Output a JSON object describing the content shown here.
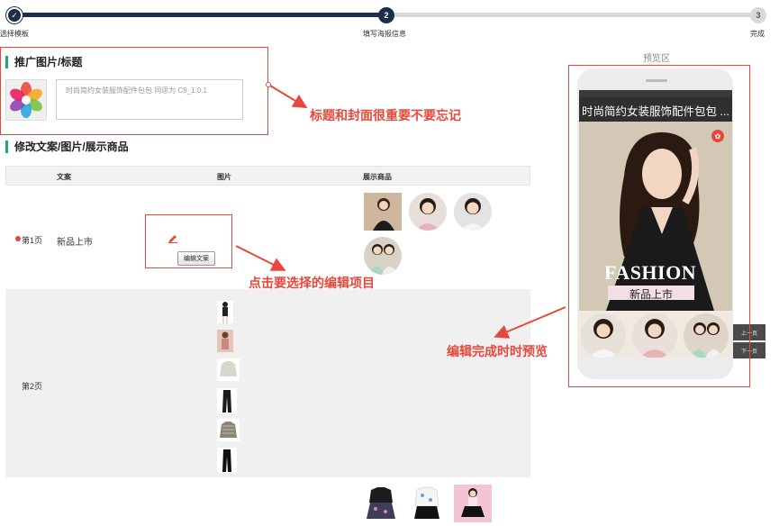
{
  "stepper": {
    "steps": [
      {
        "label": "选择模板",
        "marker": "✓"
      },
      {
        "label": "填写海报信息",
        "marker": "2"
      },
      {
        "label": "完成",
        "marker": "3"
      }
    ],
    "colors": {
      "done": "#1e2d4a",
      "pending": "#d9d9d9"
    }
  },
  "promo": {
    "heading": "推广图片/标题",
    "title_value": "时尚简约女装服饰配件包包 同思为 C9_1.0.1"
  },
  "edit": {
    "heading": "修改文案/图片/展示商品",
    "columns": [
      "文案",
      "图片",
      "展示商品"
    ],
    "rows": [
      {
        "page": "第1页",
        "copy": "新品上市",
        "button": "编辑文案"
      },
      {
        "page": "第2页",
        "copy": "",
        "button": ""
      }
    ]
  },
  "preview": {
    "heading": "预览区",
    "poster_title": "时尚简约女装服饰配件包包 ...",
    "banner_word": "FASHION",
    "banner_sub": "新品上市",
    "prev_page": "上一页",
    "next_page": "下一页"
  },
  "annotations": {
    "title_note": "标题和封面很重要不要忘记",
    "edit_note": "点击要选择的编辑项目",
    "preview_note": "编辑完成时时预览"
  },
  "colors": {
    "accent_red": "#e8483c",
    "heading_bar": "#26a17b",
    "dark_nav": "#1e2d4a"
  }
}
